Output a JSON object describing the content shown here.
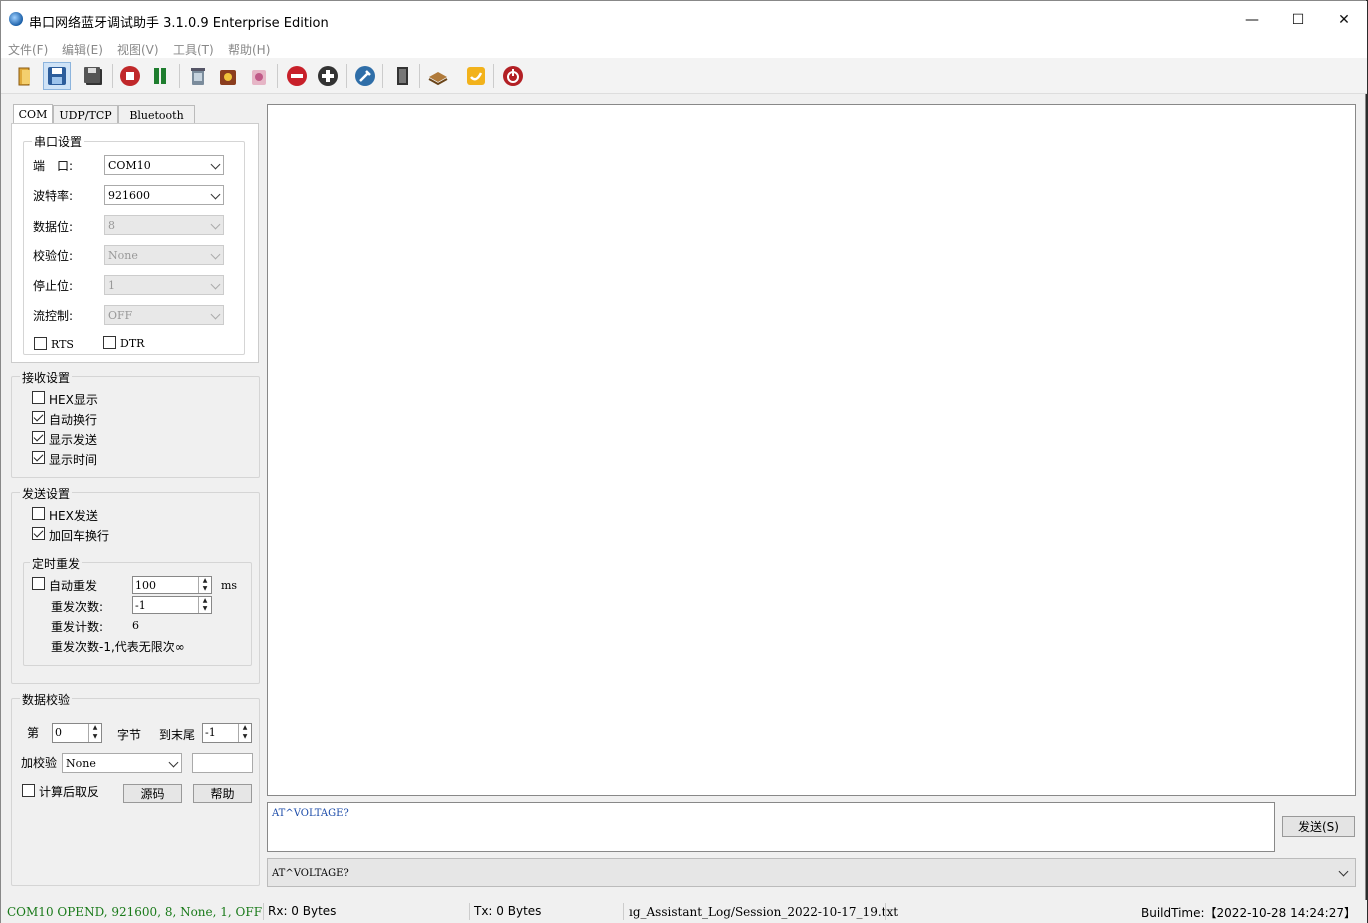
{
  "window": {
    "title": "串口网络蓝牙调试助手 3.1.0.9 Enterprise Edition",
    "minimize": "—",
    "maximize": "☐",
    "close": "✕"
  },
  "menu": [
    "文件(F)",
    "编辑(E)",
    "视图(V)",
    "工具(T)",
    "帮助(H)"
  ],
  "toolbar_icons": [
    "open-icon",
    "save-icon",
    "save-all-icon",
    "stop-icon",
    "pause-icon",
    "trash-icon",
    "recycle-icon",
    "clear-icon",
    "remove-icon",
    "add-icon",
    "settings-icon",
    "door-icon",
    "book-icon",
    "about-icon",
    "power-icon"
  ],
  "tabs": [
    "COM",
    "UDP/TCP",
    "Bluetooth"
  ],
  "serial": {
    "group_title": "串口设置",
    "port_label": "端　口:",
    "port_value": "COM10",
    "baud_label": "波特率:",
    "baud_value": "921600",
    "databits_label": "数据位:",
    "databits_value": "8",
    "parity_label": "校验位:",
    "parity_value": "None",
    "stopbits_label": "停止位:",
    "stopbits_value": "1",
    "flow_label": "流控制:",
    "flow_value": "OFF",
    "rts_label": "RTS",
    "dtr_label": "DTR"
  },
  "receive": {
    "group_title": "接收设置",
    "hex_display": "HEX显示",
    "auto_wrap": "自动换行",
    "show_send": "显示发送",
    "show_time": "显示时间"
  },
  "send": {
    "group_title": "发送设置",
    "hex_send": "HEX发送",
    "add_crlf": "加回车换行",
    "timer_title": "定时重发",
    "auto_resend": "自动重发",
    "interval_value": "100",
    "interval_unit": "ms",
    "count_label": "重发次数:",
    "count_value": "-1",
    "counter_label": "重发计数:",
    "counter_value": "6",
    "note": "重发次数-1,代表无限次∞"
  },
  "checksum": {
    "group_title": "数据校验",
    "from_label": "第",
    "from_value": "0",
    "byte_label": "字节",
    "to_end_label": "到末尾",
    "to_end_value": "-1",
    "add_check_label": "加校验",
    "check_value": "None",
    "result_value": "",
    "invert_label": "计算后取反",
    "source_button": "源码",
    "help_button": "帮助"
  },
  "send_text": "AT^VOLTAGE?",
  "send_button": "发送(S)",
  "history_value": "AT^VOLTAGE?",
  "status": {
    "conn": "COM10 OPEND, 921600, 8, None, 1, OFF",
    "rx": "Rx: 0 Bytes",
    "tx": "Tx: 0 Bytes",
    "log": "ıg_Assistant_Log/Session_2022-10-17_19.txt",
    "build": "BuildTime:【2022-10-28 14:24:27】"
  },
  "colors": {
    "status_conn": "#1a7a1a",
    "send_text": "#1a4aa8",
    "window_bg": "#f0f0f0"
  }
}
